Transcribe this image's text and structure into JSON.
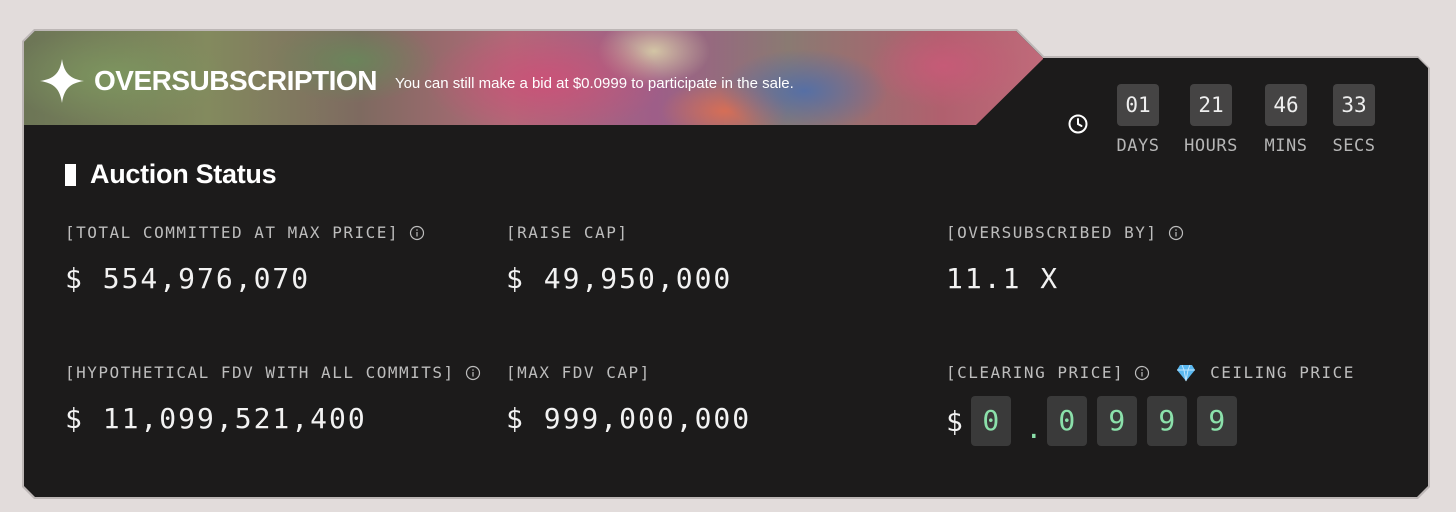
{
  "banner": {
    "title": "OVERSUBSCRIPTION",
    "subtitle": "You can still make a bid at $0.0999 to participate in the sale."
  },
  "countdown": {
    "days": "01",
    "hours": "21",
    "mins": "46",
    "secs": "33",
    "days_label": "DAYS",
    "hours_label": "HOURS",
    "mins_label": "MINS",
    "secs_label": "SECS"
  },
  "section": {
    "title": "Auction Status"
  },
  "stats": {
    "total_committed": {
      "label": "[TOTAL COMMITTED AT MAX PRICE]",
      "value": "$ 554,976,070"
    },
    "raise_cap": {
      "label": "[RAISE CAP]",
      "value": "$ 49,950,000"
    },
    "oversubscribed": {
      "label": "[OVERSUBSCRIBED BY]",
      "value": "11.1 X"
    },
    "hypothetical_fdv": {
      "label": "[HYPOTHETICAL FDV WITH ALL COMMITS]",
      "value": "$ 11,099,521,400"
    },
    "max_fdv_cap": {
      "label": "[MAX FDV CAP]",
      "value": "$ 999,000,000"
    },
    "clearing_price": {
      "label": "[CLEARING PRICE]",
      "ceiling_label": "CEILING PRICE",
      "currency": "$",
      "digits": [
        "0",
        ".",
        "0",
        "9",
        "9",
        "9"
      ]
    }
  },
  "icons": {
    "banner": "sparkle-icon",
    "countdown": "clock-icon",
    "info": "info-icon",
    "ceiling": "diamond-icon"
  },
  "colors": {
    "card_bg": "#1c1b1b",
    "page_bg": "#e2dcdb",
    "digit_box": "#3a3a3a",
    "price_digit_text": "#8be0aa",
    "diamond": "#5ab8f0"
  }
}
